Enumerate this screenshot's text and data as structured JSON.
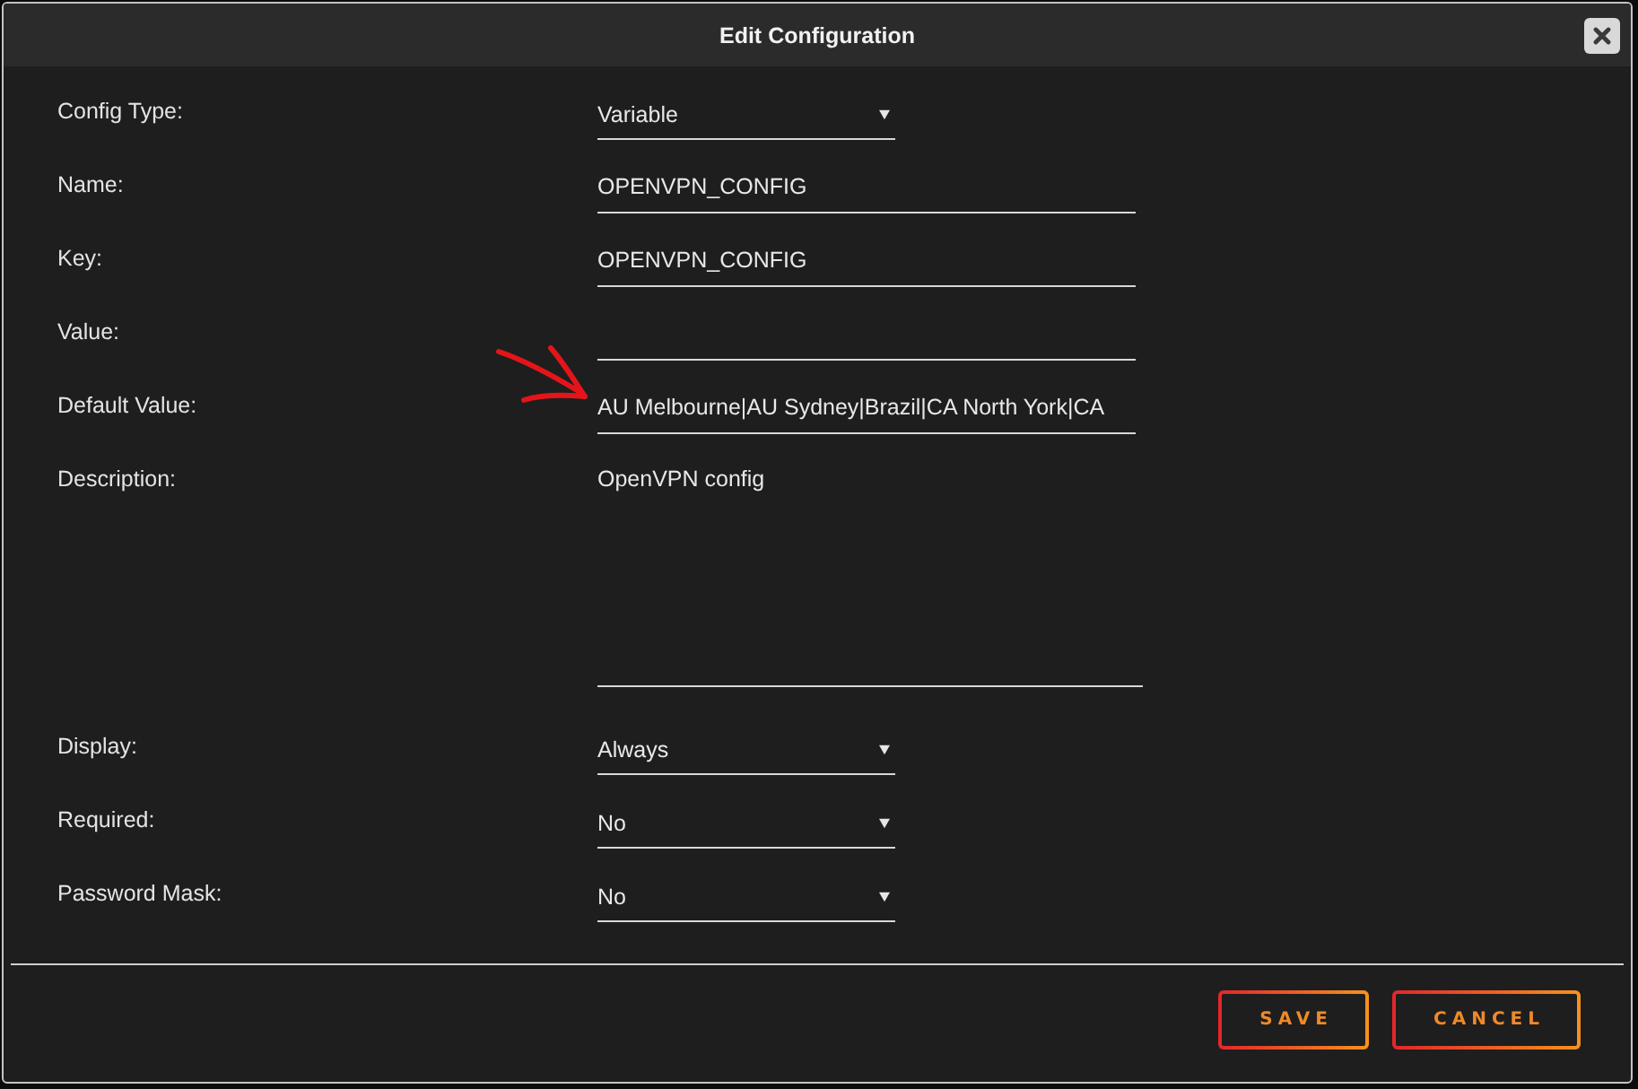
{
  "dialog": {
    "title": "Edit Configuration"
  },
  "fields": [
    {
      "label": "Config Type:",
      "kind": "select",
      "value": "Variable"
    },
    {
      "label": "Name:",
      "kind": "text",
      "value": "OPENVPN_CONFIG"
    },
    {
      "label": "Key:",
      "kind": "text",
      "value": "OPENVPN_CONFIG"
    },
    {
      "label": "Value:",
      "kind": "text"
    },
    {
      "label": "Default Value:",
      "kind": "text",
      "value": "AU Melbourne|AU Sydney|Brazil|CA North York|CA",
      "annotated": true
    },
    {
      "label": "Description:",
      "kind": "textarea",
      "value": "OpenVPN config"
    },
    {
      "label": "Display:",
      "kind": "select",
      "value": "Always"
    },
    {
      "label": "Required:",
      "kind": "select",
      "value": "No"
    },
    {
      "label": "Password Mask:",
      "kind": "select",
      "value": "No"
    }
  ],
  "buttons": [
    {
      "label": "SAVE"
    },
    {
      "label": "CANCEL"
    }
  ]
}
